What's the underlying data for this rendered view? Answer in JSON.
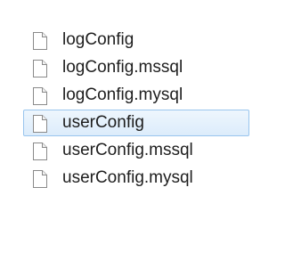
{
  "files": [
    {
      "name": "logConfig",
      "icon": "file-icon",
      "selected": false
    },
    {
      "name": "logConfig.mssql",
      "icon": "file-icon",
      "selected": false
    },
    {
      "name": "logConfig.mysql",
      "icon": "file-icon",
      "selected": false
    },
    {
      "name": "userConfig",
      "icon": "file-icon",
      "selected": true
    },
    {
      "name": "userConfig.mssql",
      "icon": "file-icon",
      "selected": false
    },
    {
      "name": "userConfig.mysql",
      "icon": "file-icon",
      "selected": false
    }
  ],
  "colors": {
    "selection_fill": "#dcecfb",
    "selection_border": "#99c5ee",
    "text": "#1e1e1e"
  }
}
